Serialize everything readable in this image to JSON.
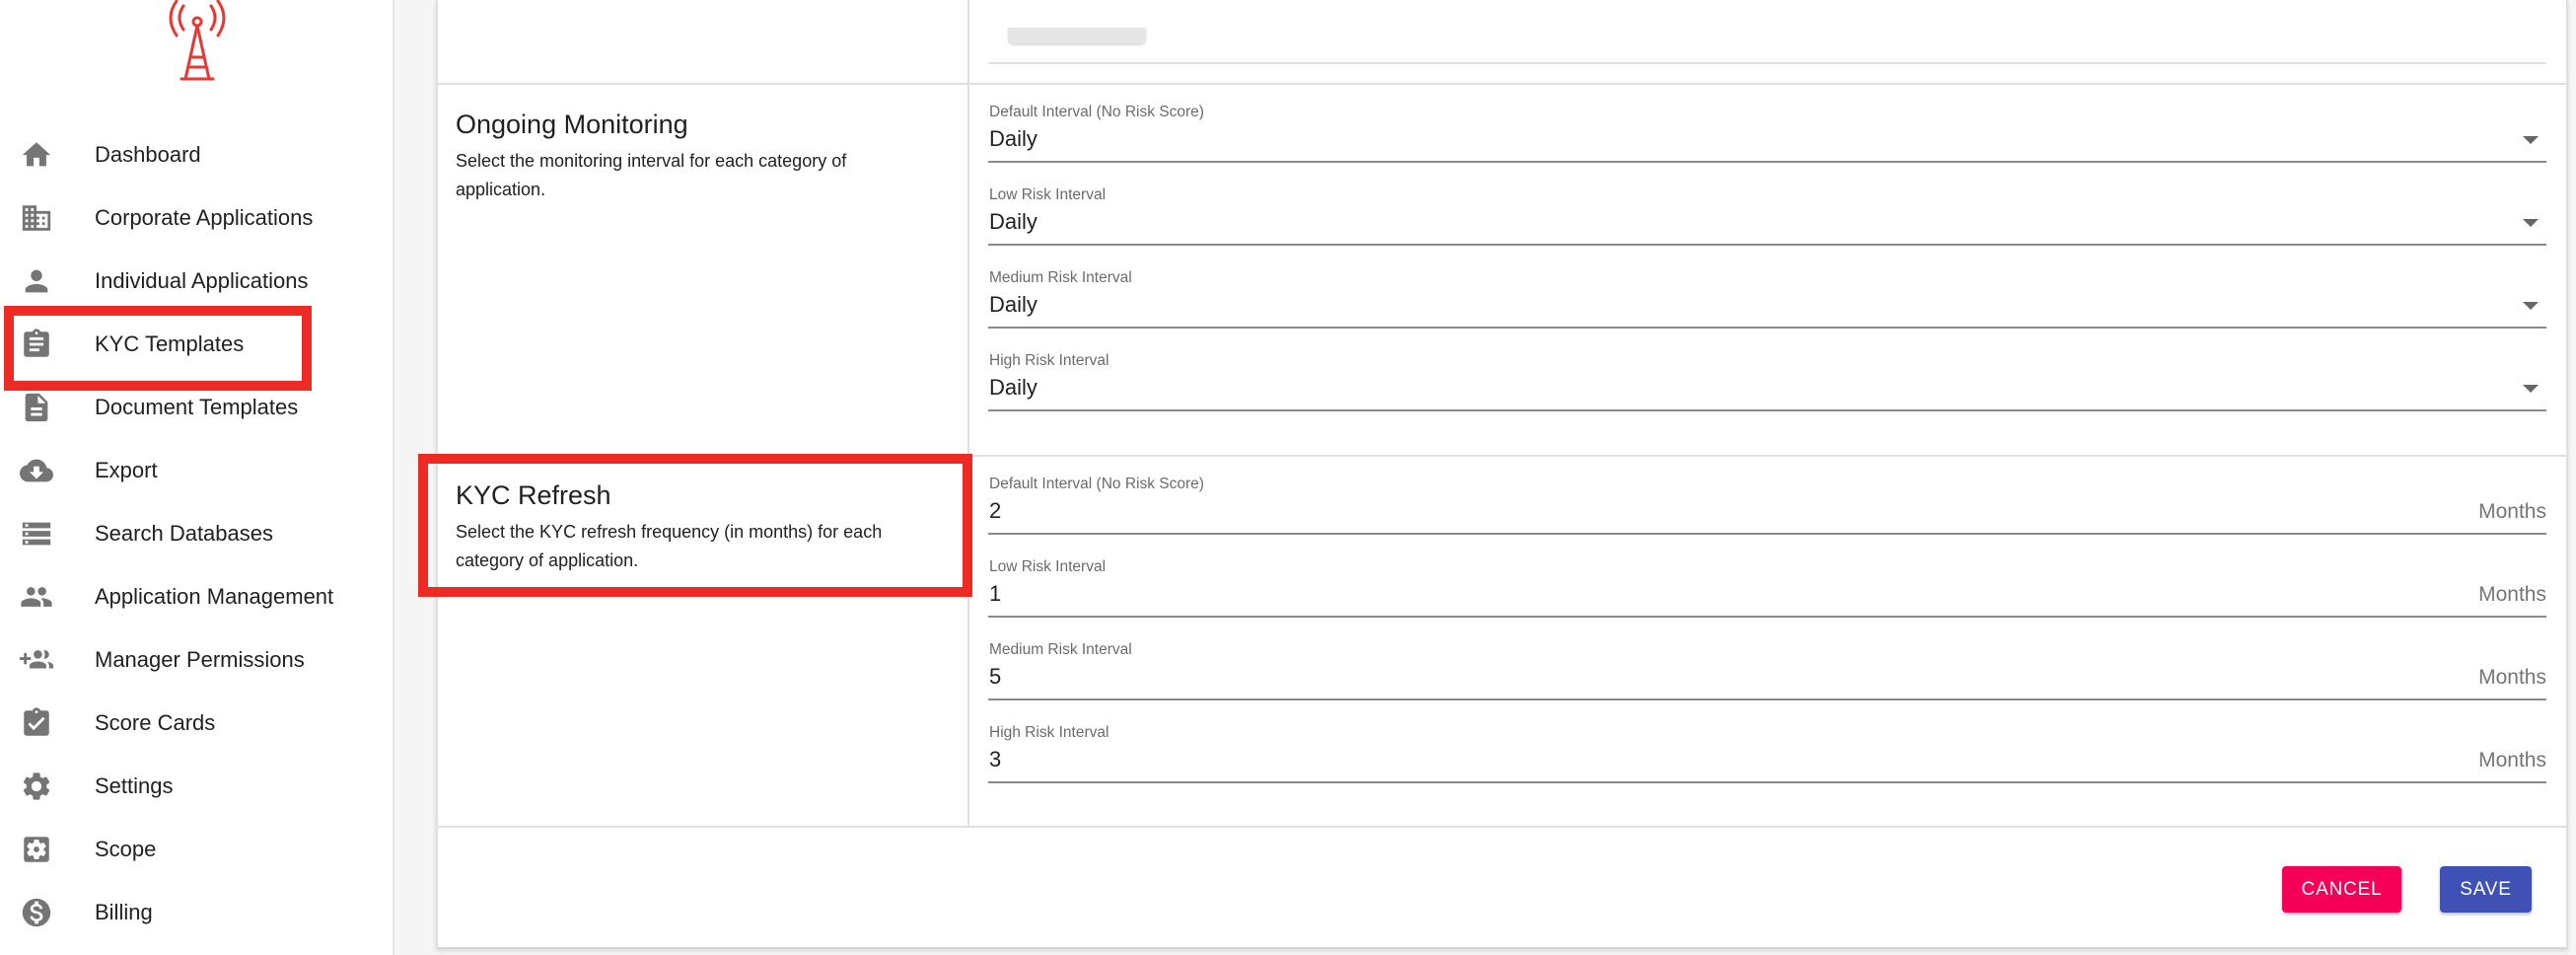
{
  "sidebar": {
    "logo": "radio-tower-logo",
    "items": [
      {
        "label": "Dashboard",
        "icon": "home-icon"
      },
      {
        "label": "Corporate Applications",
        "icon": "building-icon"
      },
      {
        "label": "Individual Applications",
        "icon": "person-icon"
      },
      {
        "label": "KYC Templates",
        "icon": "clipboard-icon"
      },
      {
        "label": "Document Templates",
        "icon": "document-icon"
      },
      {
        "label": "Export",
        "icon": "cloud-download-icon"
      },
      {
        "label": "Search Databases",
        "icon": "storage-icon"
      },
      {
        "label": "Application Management",
        "icon": "people-icon"
      },
      {
        "label": "Manager Permissions",
        "icon": "group-add-icon"
      },
      {
        "label": "Score Cards",
        "icon": "assignment-check-icon"
      },
      {
        "label": "Settings",
        "icon": "gear-icon"
      },
      {
        "label": "Scope",
        "icon": "settings-applications-icon"
      },
      {
        "label": "Billing",
        "icon": "dollar-circle-icon"
      }
    ]
  },
  "monitoring": {
    "title": "Ongoing Monitoring",
    "description": "Select the monitoring interval for each category of application.",
    "fields": [
      {
        "label": "Default Interval (No Risk Score)",
        "value": "Daily"
      },
      {
        "label": "Low Risk Interval",
        "value": "Daily"
      },
      {
        "label": "Medium Risk Interval",
        "value": "Daily"
      },
      {
        "label": "High Risk Interval",
        "value": "Daily"
      }
    ]
  },
  "refresh": {
    "title": "KYC Refresh",
    "description": "Select the KYC refresh frequency (in months) for each category of application.",
    "unit": "Months",
    "fields": [
      {
        "label": "Default Interval (No Risk Score)",
        "value": "2"
      },
      {
        "label": "Low Risk Interval",
        "value": "1"
      },
      {
        "label": "Medium Risk Interval",
        "value": "5"
      },
      {
        "label": "High Risk Interval",
        "value": "3"
      }
    ]
  },
  "actions": {
    "cancel_label": "CANCEL",
    "save_label": "SAVE"
  },
  "colors": {
    "highlight": "#ee2a24",
    "cancel": "#f50057",
    "save": "#3f51b5",
    "logo": "#e53935"
  }
}
